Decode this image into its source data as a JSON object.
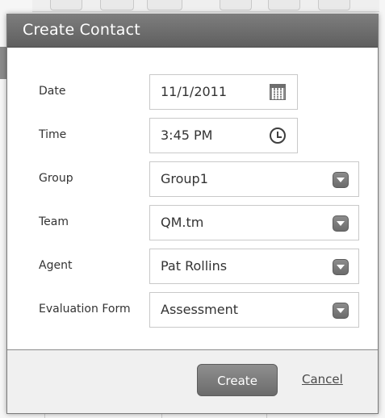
{
  "dialog": {
    "title": "Create Contact"
  },
  "form": {
    "date_label": "Date",
    "date_value": "11/1/2011",
    "time_label": "Time",
    "time_value": "3:45 PM",
    "group_label": "Group",
    "group_value": "Group1",
    "team_label": "Team",
    "team_value": "QM.tm",
    "agent_label": "Agent",
    "agent_value": "Pat Rollins",
    "form_label": "Evaluation Form",
    "form_value": "Assessment"
  },
  "footer": {
    "create_label": "Create",
    "cancel_label": "Cancel"
  },
  "icons": {
    "date_icon": "calendar-icon",
    "time_icon": "clock-icon",
    "dropdown_icon": "chevron-down-icon"
  },
  "colors": {
    "header": "#6e6e6e",
    "footer": "#f0f0f0",
    "button": "#7a7a7a"
  }
}
